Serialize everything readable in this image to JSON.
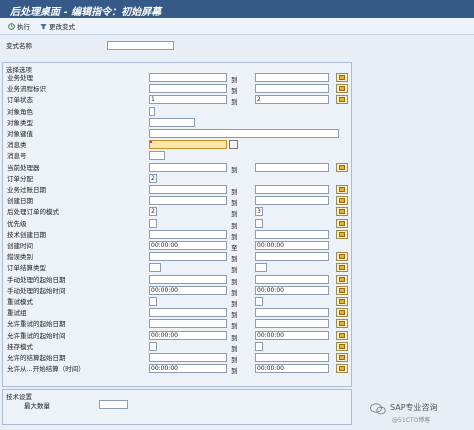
{
  "window": {
    "title": "后处理桌面 - 编辑指令：初始屏幕"
  },
  "toolbar": {
    "execute_label": "执行",
    "variant_label": "更改变式"
  },
  "variant": {
    "label": "变式名称",
    "value": ""
  },
  "selection": {
    "title": "选择选项",
    "to_label": "到",
    "fields": [
      {
        "label": "业务处理",
        "from": "",
        "to": "",
        "range": true,
        "multi": true
      },
      {
        "label": "业务流程标识",
        "from": "",
        "to": "",
        "range": true,
        "multi": true
      },
      {
        "label": "订单状态",
        "from": "1",
        "to": "2",
        "range": true,
        "multi": true
      },
      {
        "label": "对象角色",
        "from": "",
        "range": false
      },
      {
        "label": "对象类型",
        "from": "",
        "range": false
      },
      {
        "label": "对象键值",
        "from": "",
        "range": false
      },
      {
        "label": "消息类",
        "from": "",
        "range": false,
        "required": true,
        "search": true
      },
      {
        "label": "消息号",
        "from": "",
        "range": false
      },
      {
        "label": "当前处理器",
        "from": "",
        "to": "",
        "range": true,
        "multi": true
      },
      {
        "label": "订单分配",
        "from": "2",
        "range": false
      },
      {
        "label": "业务过账日期",
        "from": "",
        "to": "",
        "range": true,
        "multi": true
      },
      {
        "label": "创建日期",
        "from": "",
        "to": "",
        "range": true,
        "multi": true
      },
      {
        "label": "后处理订单的模式",
        "from": "2",
        "to": "3",
        "range": true,
        "multi": true
      },
      {
        "label": "优先级",
        "from": "",
        "to": "",
        "range": true,
        "multi": true
      },
      {
        "label": "技术创建日期",
        "from": "",
        "to": "",
        "range": true,
        "multi": true
      },
      {
        "label": "创建时间",
        "from": "00:00:00",
        "to": "00:00:00",
        "range": true,
        "multi": false,
        "to_label_override": "至"
      },
      {
        "label": "錯误类别",
        "from": "",
        "to": "",
        "range": true,
        "multi": true
      },
      {
        "label": "订单结算类型",
        "from": "",
        "to": "",
        "range": true,
        "multi": true
      },
      {
        "label": "手动处理的起始日期",
        "from": "",
        "to": "",
        "range": true,
        "multi": true
      },
      {
        "label": "手动处理的起始时间",
        "from": "00:00:00",
        "to": "00:00:00",
        "range": true,
        "multi": true
      },
      {
        "label": "重试模式",
        "from": "",
        "to": "",
        "range": true,
        "multi": true
      },
      {
        "label": "重试组",
        "from": "",
        "to": "",
        "range": true,
        "multi": true
      },
      {
        "label": "允许重试的起始日期",
        "from": "",
        "to": "",
        "range": true,
        "multi": true
      },
      {
        "label": "允许重试的起始时间",
        "from": "00:00:00",
        "to": "00:00:00",
        "range": true,
        "multi": true
      },
      {
        "label": "挂存模式",
        "from": "",
        "to": "",
        "range": true,
        "multi": true
      },
      {
        "label": "允许的结算起始日期",
        "from": "",
        "to": "",
        "range": true,
        "multi": true
      },
      {
        "label": "允许从...开始结算（时间）",
        "from": "00:00:00",
        "to": "00:00:00",
        "range": true,
        "multi": true
      }
    ]
  },
  "technical": {
    "title": "技术设置",
    "max_label": "最大数量",
    "max_value": ""
  },
  "watermark": {
    "line1": "SAP专业咨询",
    "line2": "@51CTO博客"
  }
}
